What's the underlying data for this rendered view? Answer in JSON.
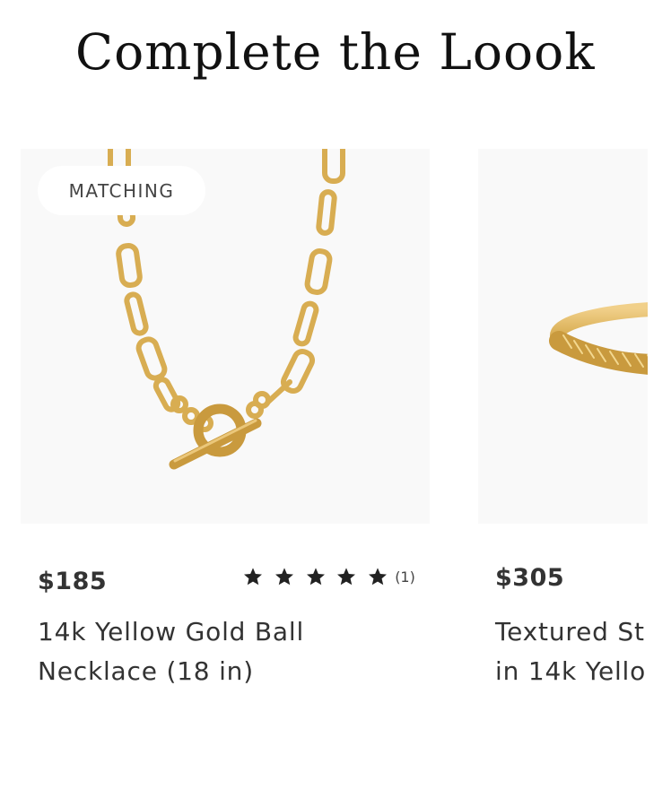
{
  "section": {
    "title": "Complete the Loook"
  },
  "products": [
    {
      "badge": "MATCHING",
      "price": "$185",
      "rating": 5,
      "review_count": "(1)",
      "name_line1": "14k Yellow Gold Ball",
      "name_line2": "Necklace (18 in)",
      "image_icon": "gold-paperclip-toggle-necklace"
    },
    {
      "price": "$305",
      "name_line1": "Textured St",
      "name_line2": "in 14k Yello",
      "image_icon": "gold-textured-ring"
    }
  ],
  "colors": {
    "gold": "#d8ad52",
    "gold_dark": "#b88a2e",
    "image_bg": "#f9f9f9",
    "star": "#222222"
  }
}
